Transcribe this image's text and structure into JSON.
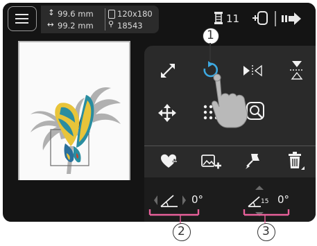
{
  "status": {
    "height": "99.6 mm",
    "width": "99.2 mm",
    "hoop_size": "120x180",
    "stitch_count": "18543",
    "thread_count": "11"
  },
  "edit_tools": [
    {
      "name": "resize-icon",
      "label": "Resize"
    },
    {
      "name": "rotate-icon",
      "label": "Rotate"
    },
    {
      "name": "mirror-horizontal-icon",
      "label": "Mirror horizontal"
    },
    {
      "name": "mirror-vertical-icon",
      "label": "Mirror vertical"
    },
    {
      "name": "move-icon",
      "label": "Move"
    },
    {
      "name": "grid-icon",
      "label": "Grid"
    },
    {
      "name": "zoom-icon",
      "label": "Zoom"
    }
  ],
  "actions": [
    {
      "name": "favorite-add-icon"
    },
    {
      "name": "add-image-icon"
    },
    {
      "name": "pin-icon"
    },
    {
      "name": "delete-icon"
    }
  ],
  "rotation": {
    "angle_value": "0°",
    "angle_step_label": "15",
    "angle_step_value": "0°"
  },
  "callouts": [
    "1",
    "2",
    "3"
  ],
  "colors": {
    "screen_bg": "#141414",
    "panel_bg": "#2a2a2a",
    "accent_blue": "#3da8e0",
    "callout_pink": "#e8609a",
    "butterfly_yellow": "#e8c43a",
    "butterfly_teal": "#2a8da0"
  }
}
